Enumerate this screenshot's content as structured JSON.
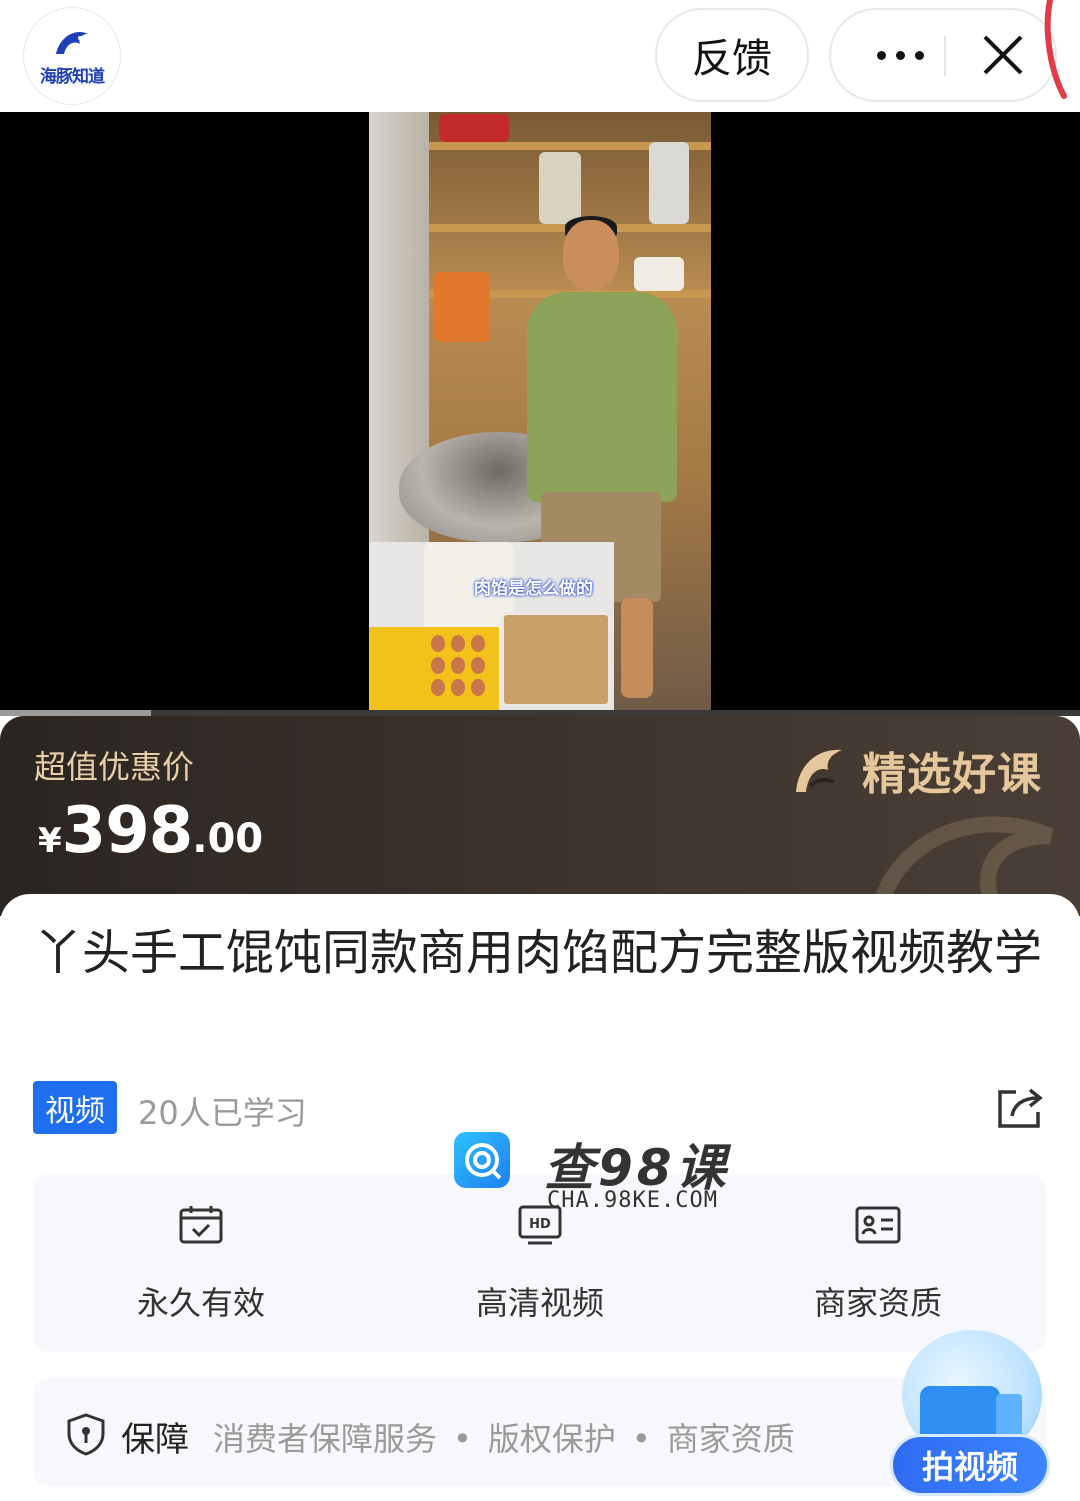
{
  "app": {
    "logo_text": "海豚知道",
    "feedback_label": "反馈"
  },
  "video": {
    "subtitle": "肉馅是怎么做的",
    "progress": 0.14
  },
  "price_banner": {
    "label": "超值优惠价",
    "currency": "¥",
    "price_integer": "398",
    "price_decimal": ".00",
    "badge_text": "精选好课"
  },
  "course": {
    "title": "丫头手工馄饨同款商用肉馅配方完整版视频教学",
    "tag": "视频",
    "learners": "20人已学习"
  },
  "features": [
    {
      "label": "永久有效",
      "icon": "calendar-check-icon"
    },
    {
      "label": "高清视频",
      "icon": "hd-screen-icon"
    },
    {
      "label": "商家资质",
      "icon": "id-card-icon"
    }
  ],
  "guarantee": {
    "title": "保障",
    "items": [
      "消费者保障服务",
      "版权保护",
      "商家资质"
    ]
  },
  "watermark": {
    "title": "查98课",
    "url": "CHA.98KE.COM"
  },
  "fab": {
    "label": "拍视频"
  },
  "colors": {
    "accent_blue": "#1e6ef0",
    "banner_gold": "#e6c79b",
    "banner_dark": "#2b2522"
  }
}
